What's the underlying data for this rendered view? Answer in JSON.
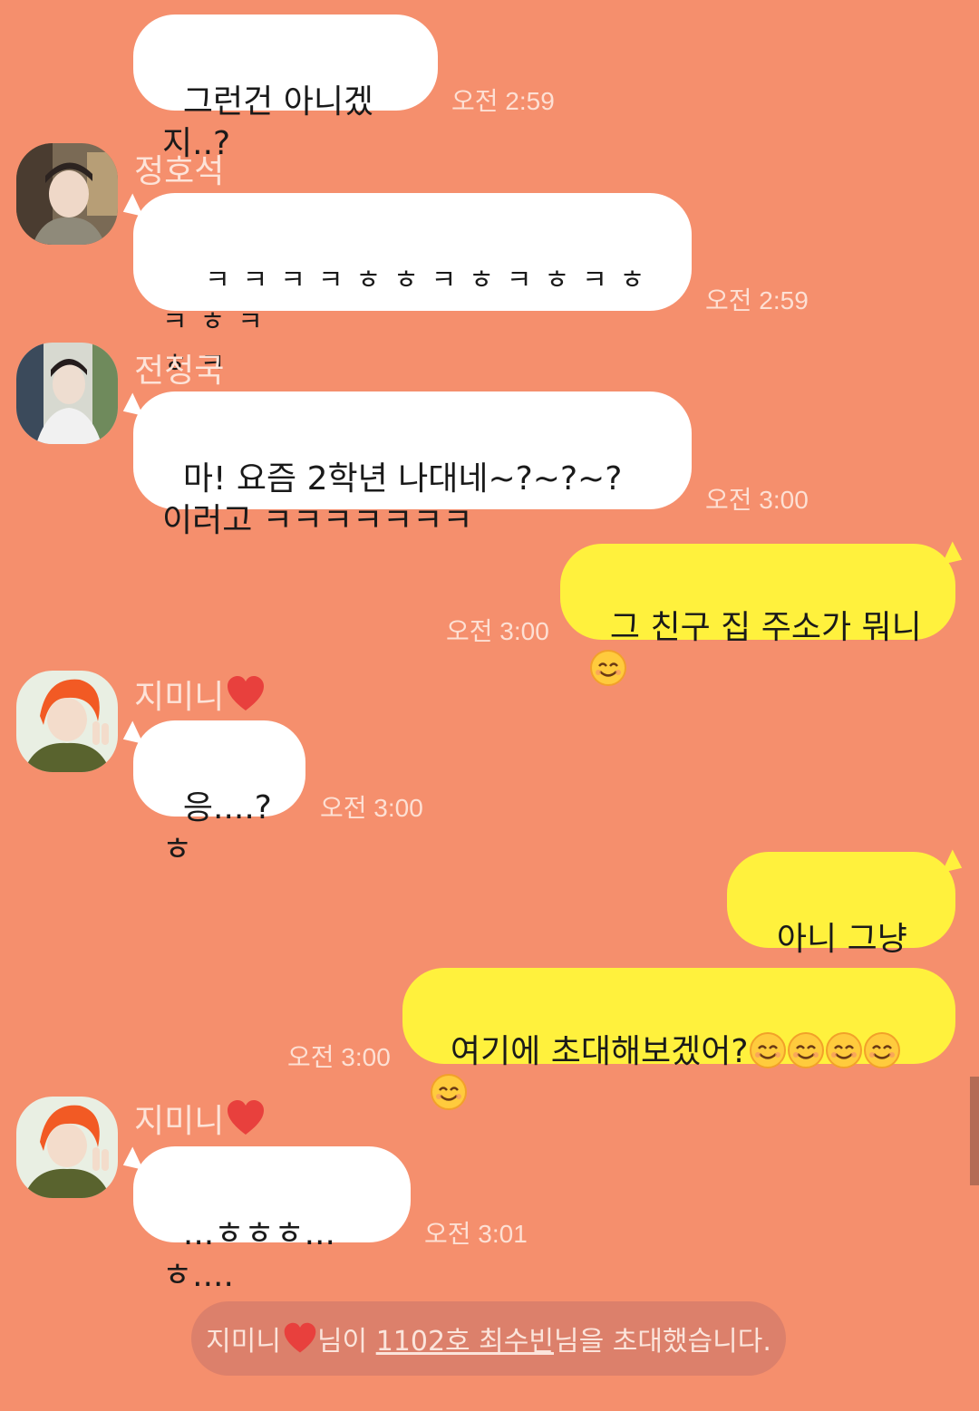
{
  "colors": {
    "background": "#f58f6d",
    "incoming_bubble": "#ffffff",
    "outgoing_bubble": "#fff13d",
    "timestamp": "#fde0d4",
    "heart": "#e8403d",
    "system_pill": "#dc806b"
  },
  "messages": [
    {
      "text": "그런건 아니겠지..?",
      "time": "오전 2:59"
    },
    {
      "sender": "정호석",
      "text": "ㅋㅋㅋㅋㅎㅎㅋㅎㅋㅎㅋㅎㅋㅎㅋ\nㅎㅋ",
      "time": "오전 2:59"
    },
    {
      "sender": "전정국",
      "text": "마! 요즘 2학년 나대네~?~?~?\n이러고 ㅋㅋㅋㅋㅋㅋㅋ",
      "time": "오전 3:00"
    },
    {
      "text": "그 친구 집 주소가 뭐니",
      "time": "오전 3:00",
      "emoji": "smiling-face-icon"
    },
    {
      "sender": "지미니",
      "text": "응....?ㅎ",
      "time": "오전 3:00"
    },
    {
      "text": "아니 그냥~~"
    },
    {
      "text": "여기에 초대해보겠어?",
      "time": "오전 3:00",
      "emoji": "smiling-face-icon",
      "emoji_count": 5
    },
    {
      "sender": "지미니",
      "text": "...ㅎㅎㅎ...ㅎ....",
      "time": "오전 3:01"
    }
  ],
  "system": {
    "inviter": "지미니",
    "middle": "님이 ",
    "invitee": "1102호 최수빈",
    "tail": "님을 초대했습니다."
  }
}
